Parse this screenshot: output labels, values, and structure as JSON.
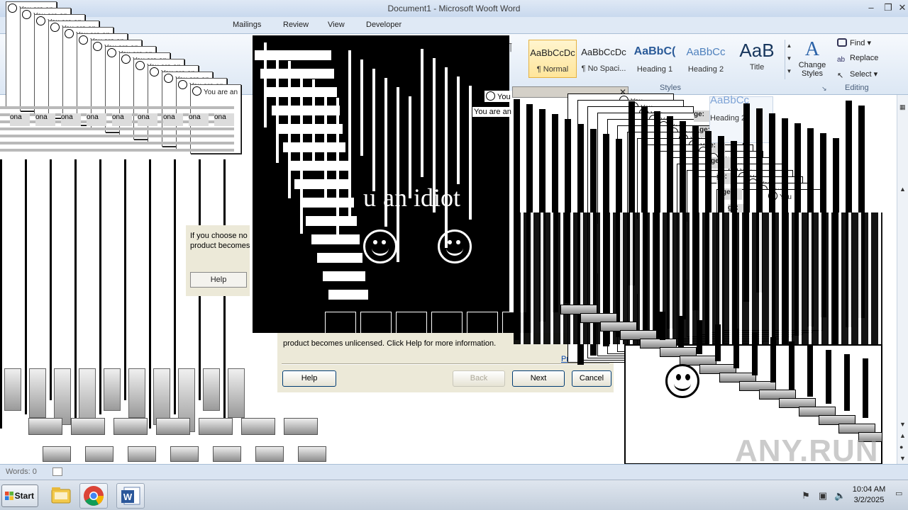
{
  "window": {
    "title": "Document1 - Microsoft Wooft Word"
  },
  "ribbon": {
    "tabs": [
      "Mailings",
      "Review",
      "View",
      "Developer"
    ],
    "styles": [
      {
        "preview": "AaBbCcDc",
        "name": "¶ Normal"
      },
      {
        "preview": "AaBbCcDc",
        "name": "¶ No Spaci..."
      },
      {
        "preview": "AaBbC(",
        "name": "Heading 1"
      },
      {
        "preview": "AaBbCc",
        "name": "Heading 2"
      },
      {
        "preview": "AaB",
        "name": "Title"
      }
    ],
    "change_styles_label": "Change Styles",
    "styles_group_label": "Styles",
    "editing": {
      "find": "Find",
      "replace": "Replace",
      "select": "Select",
      "group_label": "Editing"
    },
    "ghost_style": {
      "preview": "AaBbCc",
      "name": "Heading 2"
    }
  },
  "popups": {
    "idiot_text": "an idiot",
    "idiot_prefix": "u",
    "mini_title": "You are an",
    "mini_label": "You",
    "mini_side": "ge:",
    "mini_col": "ona",
    "side_dialog": {
      "message_line1": "If you choose no",
      "message_line2": "product becomes",
      "help": "Help"
    },
    "activation": {
      "message": "product becomes unlicensed. Click Help for more information.",
      "privacy_link": "Privacy S",
      "help": "Help",
      "back": "Back",
      "next": "Next",
      "cancel": "Cancel"
    }
  },
  "status_bar": {
    "words": "Words: 0"
  },
  "watermark": "ANY.RUN",
  "taskbar": {
    "start_label": "Start",
    "apps": [
      "file-explorer-icon",
      "chrome-icon",
      "word-icon"
    ],
    "clock_time": "10:04 AM",
    "clock_date": "3/2/2025"
  },
  "colors": {
    "ribbon_accent": "#2a62a8",
    "selected_style": "#ffe59a",
    "link": "#0645ad"
  }
}
